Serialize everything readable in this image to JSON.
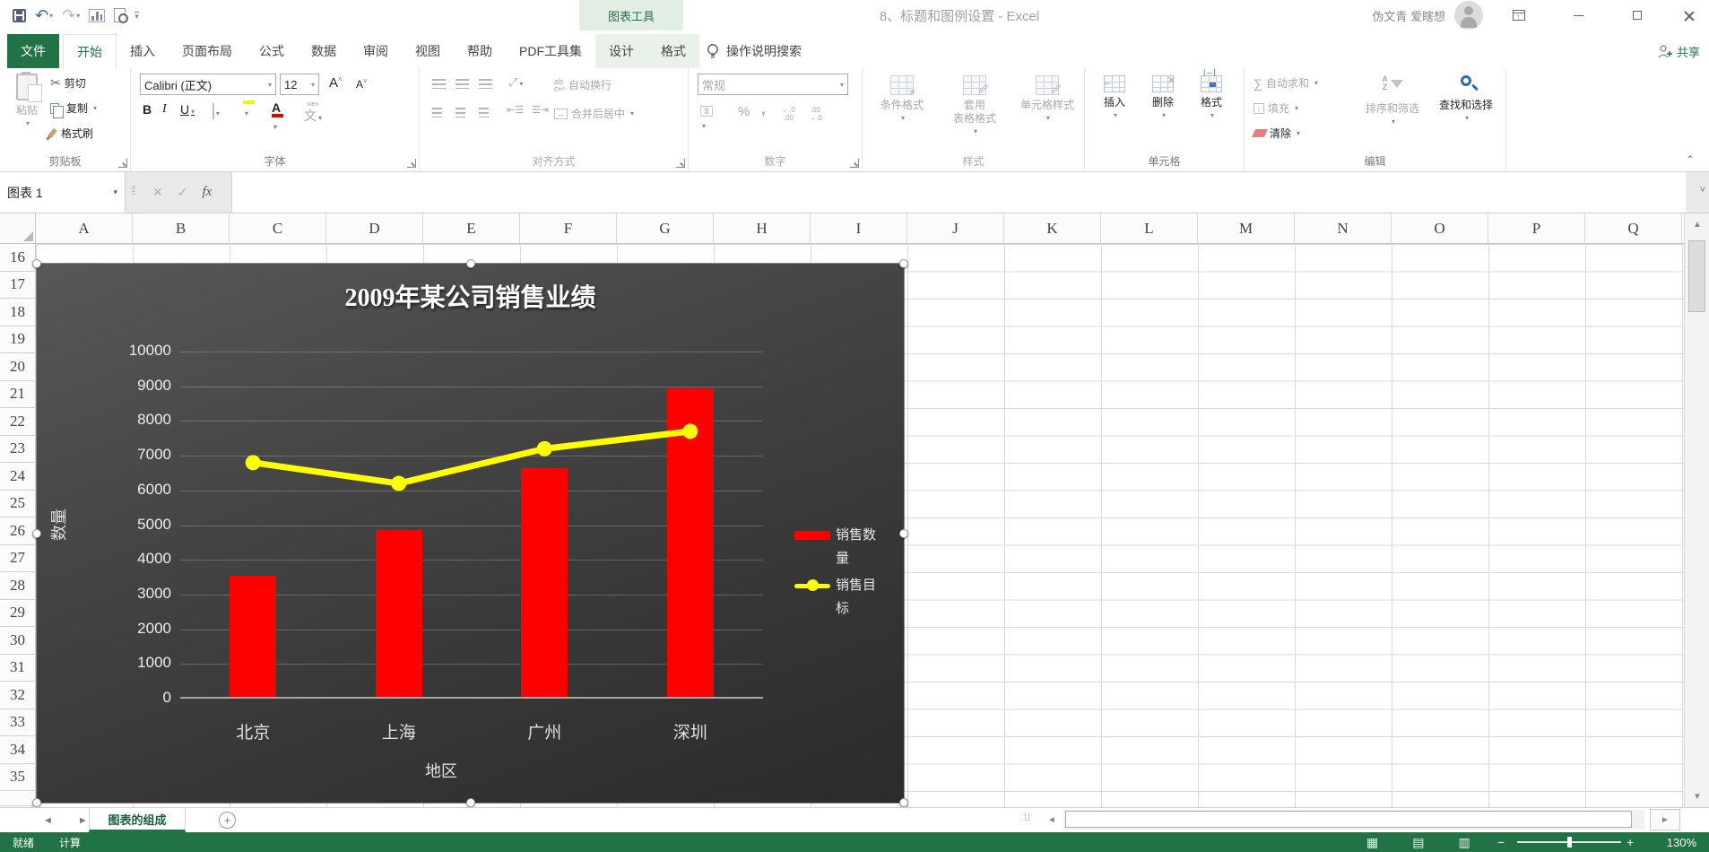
{
  "titlebar": {
    "context_label": "图表工具",
    "title": "8、标题和图例设置 - Excel",
    "user": "伪文青 爱瞎想"
  },
  "icons": {
    "undo": "↶",
    "redo": "↷",
    "cancel": "✕",
    "enter": "✓",
    "fx": "fx",
    "bold": "B",
    "italic": "I",
    "underline": "U",
    "sum": "∑",
    "percent": "%",
    "comma": ",",
    "wen": "文",
    "font_bigger": "A",
    "font_smaller": "A",
    "dec_left": "←.0\n.00",
    "dec_right": ".00\n→.0",
    "up": "▲",
    "down": "▼",
    "left": "◄",
    "right": "►",
    "view_normal": "▦",
    "view_page": "▤",
    "view_break": "▥",
    "plus": "+",
    "minus": "−",
    "collapse": "⌃",
    "expand_formula": "˅",
    "bulb": "💡",
    "dots": "⁞⁞"
  },
  "ribbon": {
    "file_tab": "文件",
    "tabs": [
      {
        "label": "开始",
        "active": true
      },
      {
        "label": "插入"
      },
      {
        "label": "页面布局"
      },
      {
        "label": "公式"
      },
      {
        "label": "数据"
      },
      {
        "label": "审阅"
      },
      {
        "label": "视图"
      },
      {
        "label": "帮助"
      },
      {
        "label": "PDF工具集"
      },
      {
        "label": "设计",
        "context": true
      },
      {
        "label": "格式",
        "context": true
      }
    ],
    "tell_me": "操作说明搜索",
    "share_label": "共享",
    "groups": {
      "clipboard": {
        "label": "剪贴板",
        "paste": "粘贴",
        "cut": "剪切",
        "copy": "复制",
        "format_painter": "格式刷"
      },
      "font": {
        "label": "字体",
        "font_name": "Calibri (正文)",
        "font_size": "12"
      },
      "alignment": {
        "label": "对齐方式",
        "wrap_text": "自动换行",
        "merge_center": "合并后居中"
      },
      "number": {
        "label": "数字",
        "format": "常规"
      },
      "styles": {
        "label": "样式",
        "conditional": "条件格式",
        "format_table_1": "套用",
        "format_table_2": "表格格式",
        "cell_styles": "单元格样式"
      },
      "cells": {
        "label": "单元格",
        "insert": "插入",
        "delete": "删除",
        "format": "格式"
      },
      "editing": {
        "label": "编辑",
        "autosum": "自动求和",
        "fill": "填充",
        "clear": "清除",
        "sort_filter": "排序和筛选",
        "find_select": "查找和选择"
      }
    }
  },
  "formula_bar": {
    "name_box": "图表 1",
    "formula": ""
  },
  "grid": {
    "columns": [
      "A",
      "B",
      "C",
      "D",
      "E",
      "F",
      "G",
      "H",
      "I",
      "J",
      "K",
      "L",
      "M",
      "N",
      "O",
      "P",
      "Q"
    ],
    "rows": [
      16,
      17,
      18,
      19,
      20,
      21,
      22,
      23,
      24,
      25,
      26,
      27,
      28,
      29,
      30,
      31,
      32,
      33,
      34,
      35
    ]
  },
  "chart_data": {
    "type": "combo",
    "title": "2009年某公司销售业绩",
    "categories": [
      "北京",
      "上海",
      "广州",
      "深圳"
    ],
    "series": [
      {
        "name": "销售数量",
        "type": "bar",
        "color": "#ff0000",
        "values": [
          3500,
          4800,
          6600,
          8900
        ]
      },
      {
        "name": "销售目标",
        "type": "line",
        "color": "#ffff00",
        "values": [
          6800,
          6200,
          7200,
          7700
        ]
      }
    ],
    "xlabel": "地区",
    "ylabel": "数量",
    "ylim": [
      0,
      10000
    ],
    "ytick_step": 1000,
    "legend_position": "right",
    "grid": true,
    "background": "dark-gray-gradient"
  },
  "sheet_tabs": {
    "active": "图表的组成"
  },
  "status_bar": {
    "ready": "就绪",
    "calc": "计算",
    "zoom": "130%"
  }
}
